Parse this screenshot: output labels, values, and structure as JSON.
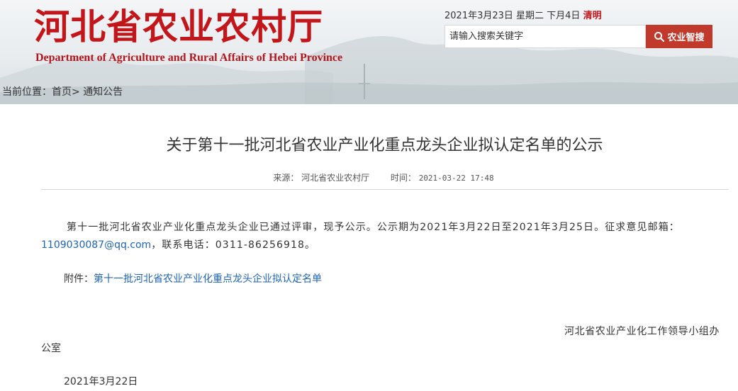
{
  "header": {
    "site_title": "河北省农业农村厅",
    "site_subtitle": "Department of  Agriculture and  Rural Affairs  of Hebei Province",
    "date_text": "2021年3月23日  星期二  下月4日",
    "weather": "清明",
    "search": {
      "placeholder": "请输入搜索关键字"
    },
    "smart_button_label": "农业智搜"
  },
  "breadcrumb": {
    "prefix": "当前位置：",
    "home": "首页",
    "separator": ">",
    "current": "通知公告"
  },
  "article": {
    "title": "关于第十一批河北省农业产业化重点龙头企业拟认定名单的公示",
    "source_label": "来源：",
    "source": "河北省农业农村厅",
    "time_label": "时间：",
    "time": "2021-03-22 17:48",
    "body_part1": "第十一批河北省农业产业化重点龙头企业已通过评审，现予公示。公示期为2021年3月22日至2021年3月25日。征求意见邮箱：",
    "email": "1109030087@qq.com",
    "body_part2": "，联系电话：0311-86256918。",
    "attachment_label": "附件：",
    "attachment_link": "第十一批河北省农业产业化重点龙头企业拟认定名单",
    "signature_line1": "河北省农业产业化工作领导小组办",
    "signature_line2": "公室",
    "signature_date": "2021年3月22日"
  },
  "colors": {
    "brand_red": "#c2161b",
    "button_red": "#c0392b",
    "link_blue": "#1e64b4"
  }
}
